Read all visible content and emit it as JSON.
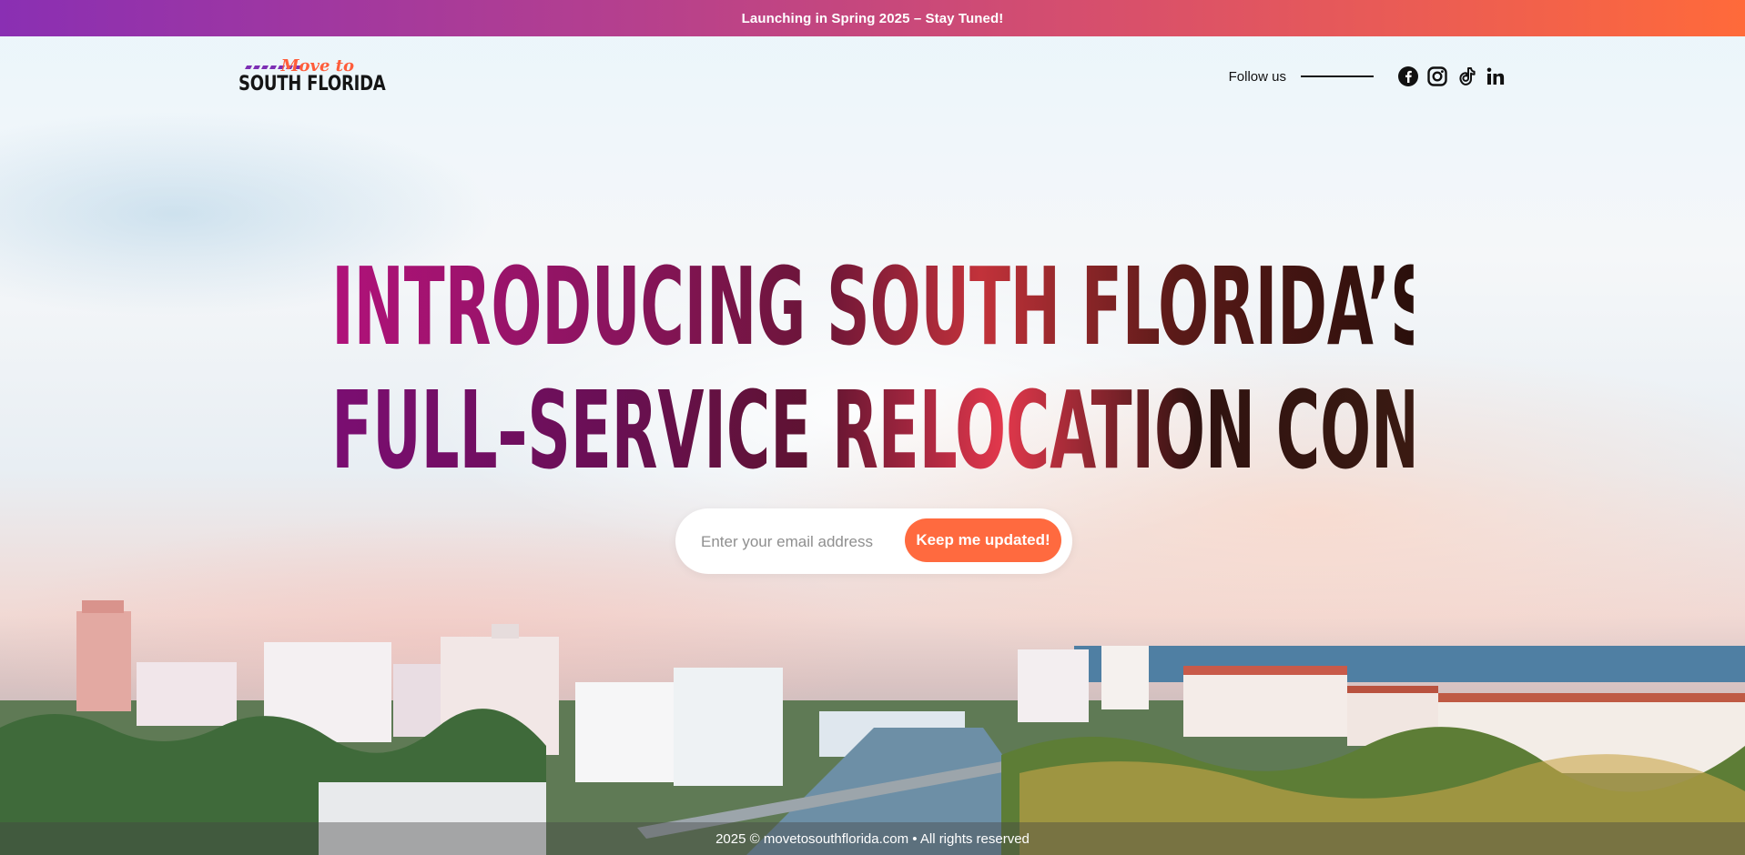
{
  "announcement": {
    "text": "Launching in Spring 2025 – Stay Tuned!"
  },
  "header": {
    "logo": {
      "line1": "Move to",
      "line2": "SOUTH FLORIDA"
    },
    "follow_label": "Follow us",
    "social": [
      {
        "icon": "facebook-icon"
      },
      {
        "icon": "instagram-icon"
      },
      {
        "icon": "tiktok-icon"
      },
      {
        "icon": "linkedin-icon"
      }
    ]
  },
  "hero": {
    "headline_line1": "INTRODUCING SOUTH FLORIDA’S DEFINITIVE",
    "headline_line2": "FULL–SERVICE RELOCATION CONCIERGE",
    "email_placeholder": "Enter your email address",
    "email_value": "",
    "submit_label": "Keep me updated!"
  },
  "footer": {
    "text": "2025 © movetosouthflorida.com • All rights reserved"
  },
  "colors": {
    "accent": "#ff6a3f",
    "banner_start": "#8a2fb3",
    "banner_end": "#ff6a3a",
    "headline_magenta": "#b0127a",
    "headline_dark": "#2a0f0b"
  }
}
